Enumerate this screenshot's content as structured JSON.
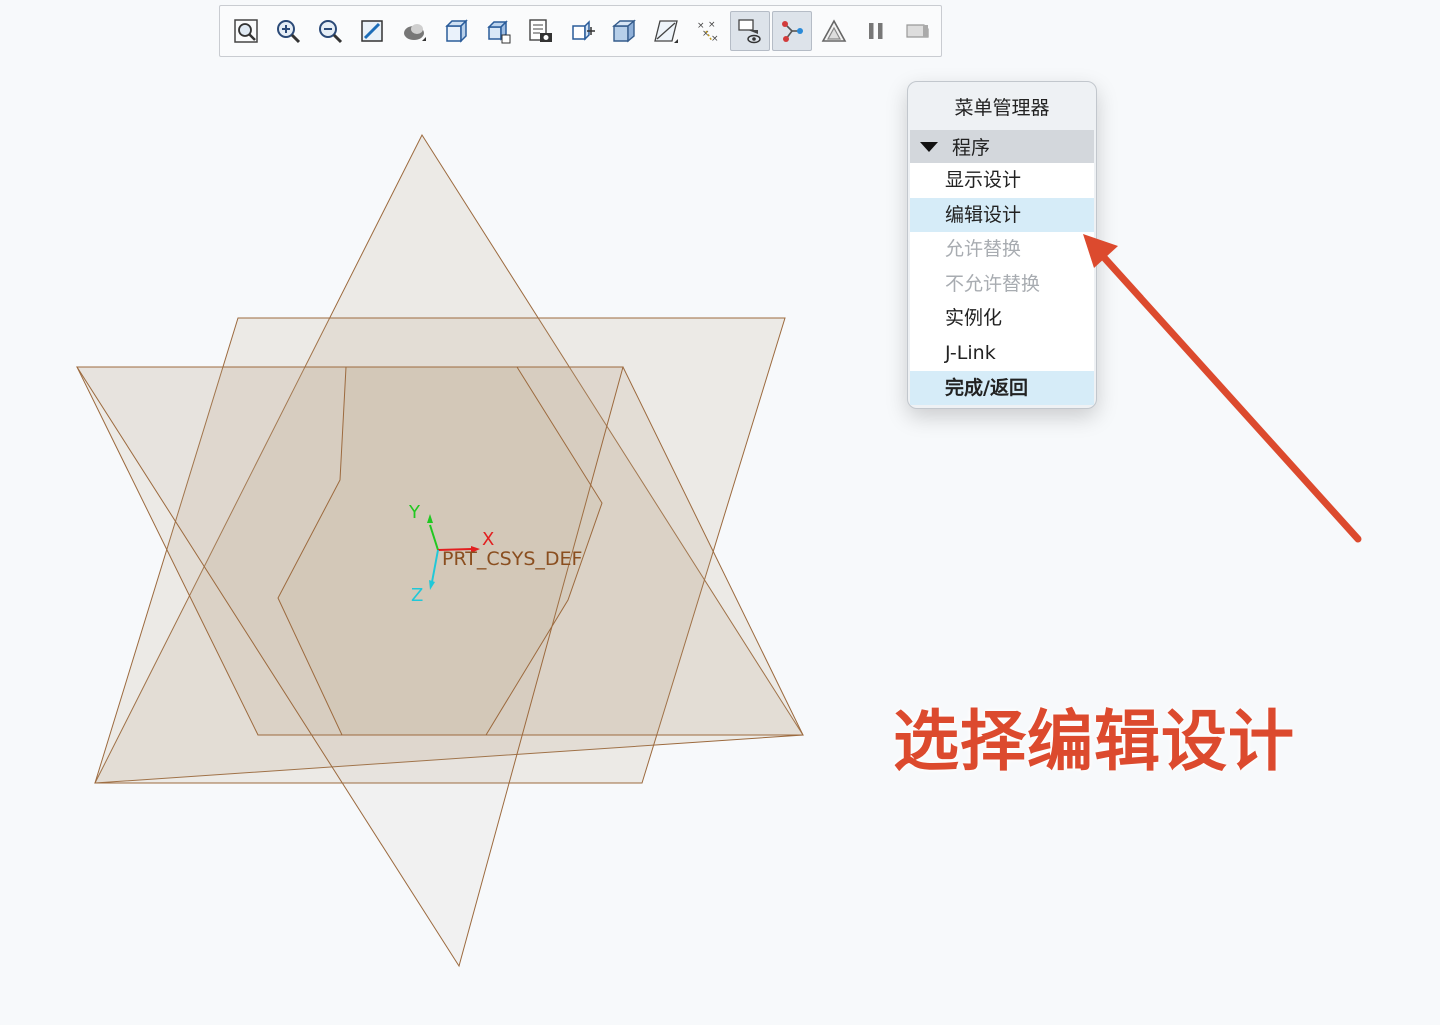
{
  "toolbar": {
    "buttons": [
      {
        "icon": "refit-icon"
      },
      {
        "icon": "zoom-in-icon"
      },
      {
        "icon": "zoom-out-icon"
      },
      {
        "icon": "repaint-icon"
      },
      {
        "icon": "view-manager-icon"
      },
      {
        "icon": "display-style-icon"
      },
      {
        "icon": "saved-orientations-icon"
      },
      {
        "icon": "view-list-icon"
      },
      {
        "icon": "plane-display-icon"
      },
      {
        "icon": "axis-display-icon"
      },
      {
        "icon": "datum-plane-tag-icon"
      },
      {
        "icon": "point-display-icon"
      },
      {
        "icon": "csys-display-icon",
        "active": true
      },
      {
        "icon": "spin-center-icon",
        "active": true
      },
      {
        "icon": "annotation-display-icon"
      },
      {
        "icon": "pause-icon"
      },
      {
        "icon": "next-icon"
      }
    ]
  },
  "viewport": {
    "csys_label": "PRT_CSYS_DEF",
    "axis_y": "Y",
    "axis_x": "X",
    "axis_z": "Z"
  },
  "menu": {
    "title": "菜单管理器",
    "section": "程序",
    "items": [
      {
        "label": "显示设计"
      },
      {
        "label": "编辑设计",
        "highlighted": true
      },
      {
        "label": "允许替换",
        "disabled": true
      },
      {
        "label": "不允许替换",
        "disabled": true
      },
      {
        "label": "实例化"
      },
      {
        "label": "J-Link"
      },
      {
        "label": "完成/返回",
        "highlighted": true,
        "bold": true
      }
    ]
  },
  "annotation": {
    "caption": "选择编辑设计",
    "color": "#dc4a2e"
  },
  "colors": {
    "plane_fill": "#b39a7a",
    "plane_edge": "#9c6a3e",
    "background": "#f7f9fb"
  }
}
